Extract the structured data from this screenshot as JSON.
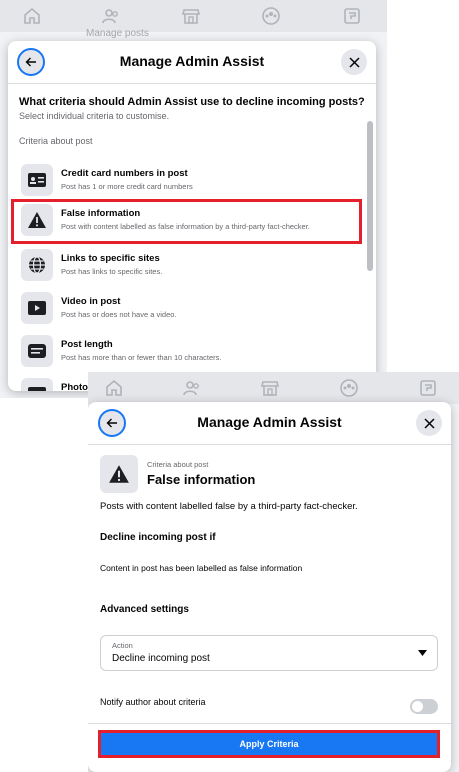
{
  "colors": {
    "accent": "#1877f2",
    "highlight": "#e3202c",
    "icon_bg": "#e4e6eb"
  },
  "panel1": {
    "nav_icons": [
      "home-icon",
      "friends-icon",
      "marketplace-icon",
      "groups-icon",
      "pages-icon"
    ],
    "bg_text": "Manage posts",
    "title": "Manage Admin Assist",
    "question": "What criteria should Admin Assist use to decline incoming posts?",
    "question_sub": "Select individual criteria to customise.",
    "section": "Criteria about post",
    "criteria": [
      {
        "icon": "credit-card-icon",
        "title": "Credit card numbers in post",
        "subtitle": "Post has 1 or more credit card numbers"
      },
      {
        "icon": "warning-icon",
        "title": "False information",
        "subtitle": "Post with content labelled as false information by a third-party fact-checker."
      },
      {
        "icon": "globe-icon",
        "title": "Links to specific sites",
        "subtitle": "Post has links to specific sites."
      },
      {
        "icon": "video-icon",
        "title": "Video in post",
        "subtitle": "Post has or does not have a video."
      },
      {
        "icon": "text-lines-icon",
        "title": "Post length",
        "subtitle": "Post has more than or fewer than 10 characters."
      },
      {
        "icon": "photo-icon",
        "title": "Photo",
        "subtitle": ""
      }
    ]
  },
  "panel2": {
    "title": "Manage Admin Assist",
    "category": "Criteria about post",
    "criterion_title": "False information",
    "description": "Posts with content labelled false by a third-party fact-checker.",
    "decline_heading": "Decline incoming post if",
    "condition": "Content in post has been labelled as false information",
    "advanced_heading": "Advanced settings",
    "action_label": "Action",
    "action_value": "Decline incoming post",
    "notify_label": "Notify author about criteria",
    "notify_enabled": false,
    "apply_label": "Apply Criteria"
  }
}
